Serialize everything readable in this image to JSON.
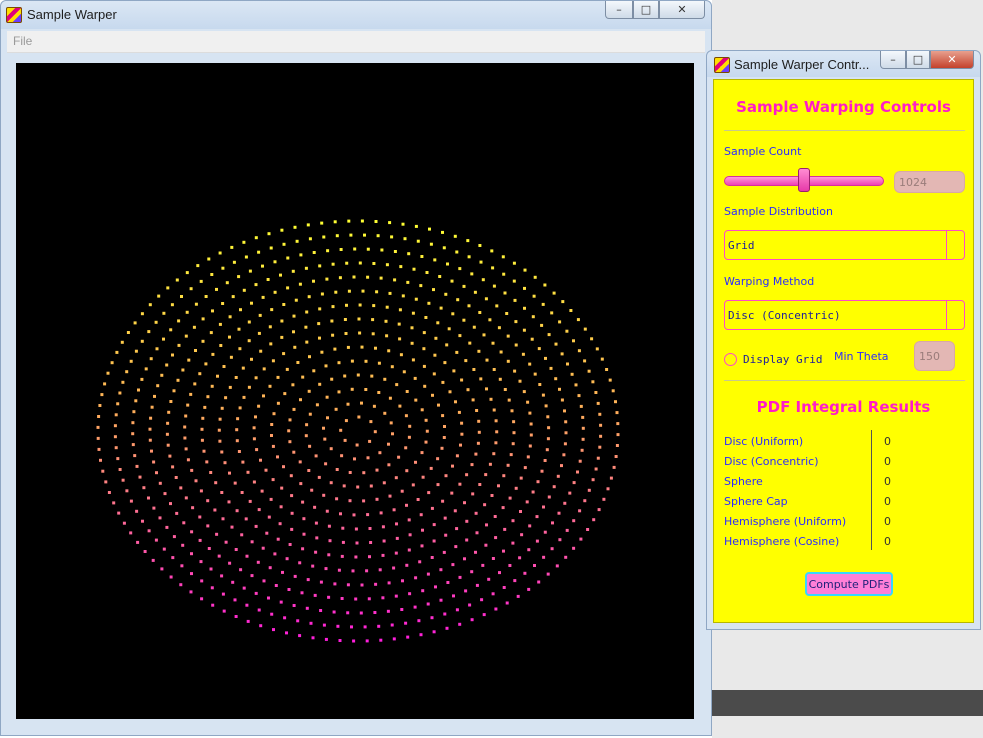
{
  "main_window": {
    "title": "Sample Warper",
    "menu": {
      "file_label": "File"
    },
    "buttons": {
      "minimize": "–",
      "maximize": "□",
      "close": "✕"
    }
  },
  "controls_window": {
    "title": "Sample Warper Contr...",
    "buttons": {
      "minimize": "–",
      "maximize": "□",
      "close": "✕"
    },
    "heading": "Sample Warping Controls",
    "sample_count": {
      "label": "Sample Count",
      "value": "1024",
      "slider_fraction": 0.5
    },
    "sample_distribution": {
      "label": "Sample Distribution",
      "selected": "Grid"
    },
    "warping_method": {
      "label": "Warping Method",
      "selected": "Disc (Concentric)"
    },
    "display_grid": {
      "label": "Display Grid",
      "checked": false
    },
    "min_theta": {
      "label": "Min Theta",
      "value": "150"
    },
    "results": {
      "heading": "PDF Integral Results",
      "rows": [
        {
          "name": "Disc (Uniform)",
          "value": "0"
        },
        {
          "name": "Disc (Concentric)",
          "value": "0"
        },
        {
          "name": "Sphere",
          "value": "0"
        },
        {
          "name": "Sphere Cap",
          "value": "0"
        },
        {
          "name": "Hemisphere (Uniform)",
          "value": "0"
        },
        {
          "name": "Hemisphere (Cosine)",
          "value": "0"
        }
      ]
    },
    "compute_button": "Compute PDFs"
  },
  "colors": {
    "panel_bg": "#ffff00",
    "accent_pink": "#ff1cc8",
    "label_blue": "#2b2bff",
    "point_top": "#ffff33",
    "point_mid": "#ffaa55",
    "point_bottom": "#ff22dd",
    "canvas_bg": "#000000"
  },
  "icons": {
    "app_icon": "app-logo-icon",
    "combo_arrow": "chevron-down-icon"
  }
}
